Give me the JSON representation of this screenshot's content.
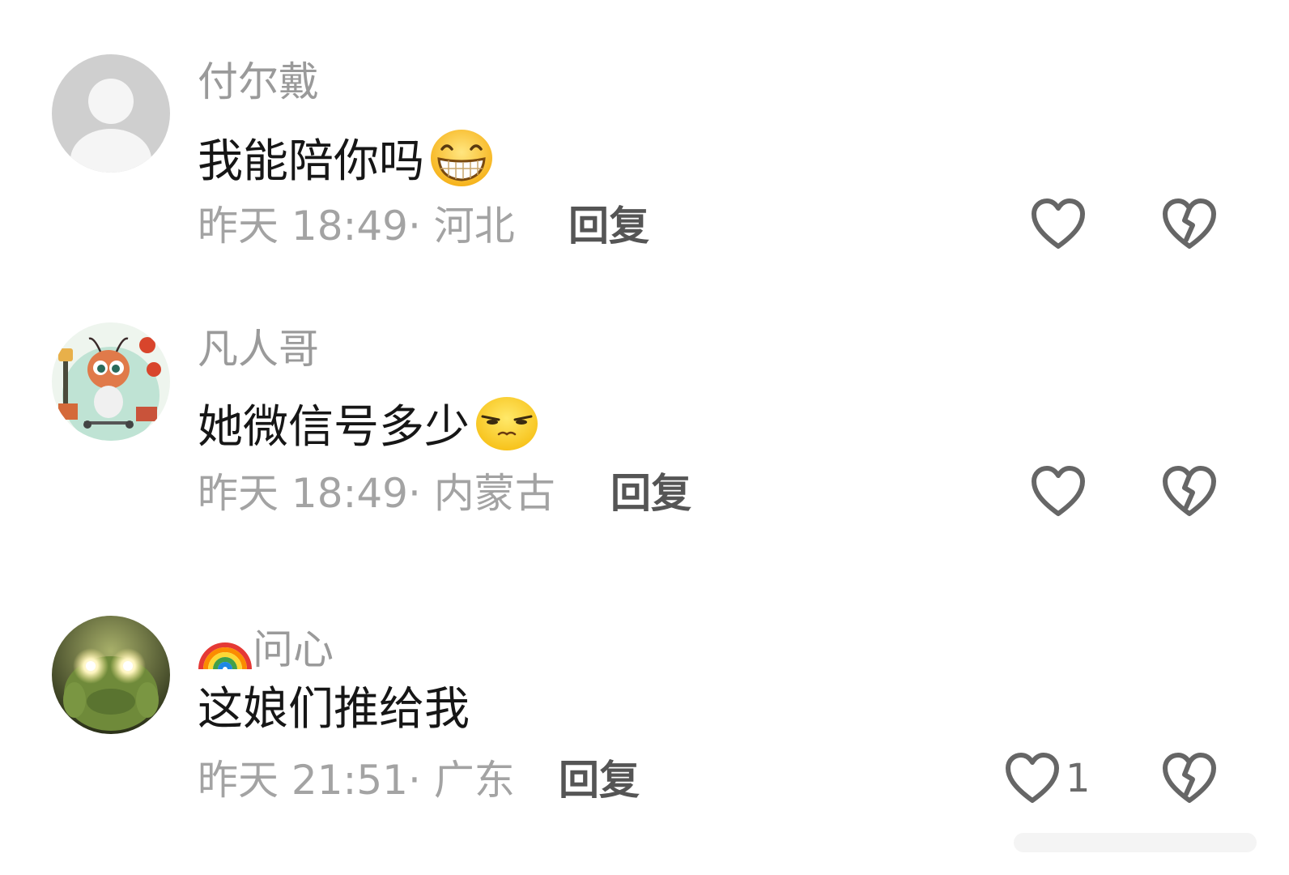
{
  "comments": [
    {
      "username": "付尔戴",
      "text": "我能陪你吗",
      "emoji": "grinning-emoji",
      "time": "昨天 18:49",
      "location": "河北",
      "meta": "昨天 18:49· 河北",
      "reply_label": "回复",
      "like_count": "",
      "avatar": "default-avatar"
    },
    {
      "username": "凡人哥",
      "text": "她微信号多少",
      "emoji": "squinting-emoji",
      "time": "昨天 18:49",
      "location": "内蒙古",
      "meta": "昨天 18:49· 内蒙古",
      "reply_label": "回复",
      "like_count": "",
      "avatar": "cartoon-ant-avatar"
    },
    {
      "username_prefix_icon": "rainbow-icon",
      "username": "问心",
      "text": "这娘们推给我",
      "emoji": "",
      "time": "昨天 21:51",
      "location": "广东",
      "meta": "昨天 21:51· 广东",
      "reply_label": "回复",
      "like_count": "1",
      "avatar": "glowing-eyes-frog-avatar"
    }
  ],
  "colors": {
    "username": "#9a9a9a",
    "text": "#161616",
    "meta": "#a3a3a3",
    "reply": "#555555",
    "icon": "#666666",
    "emoji_yellow": "#ffd12a"
  }
}
